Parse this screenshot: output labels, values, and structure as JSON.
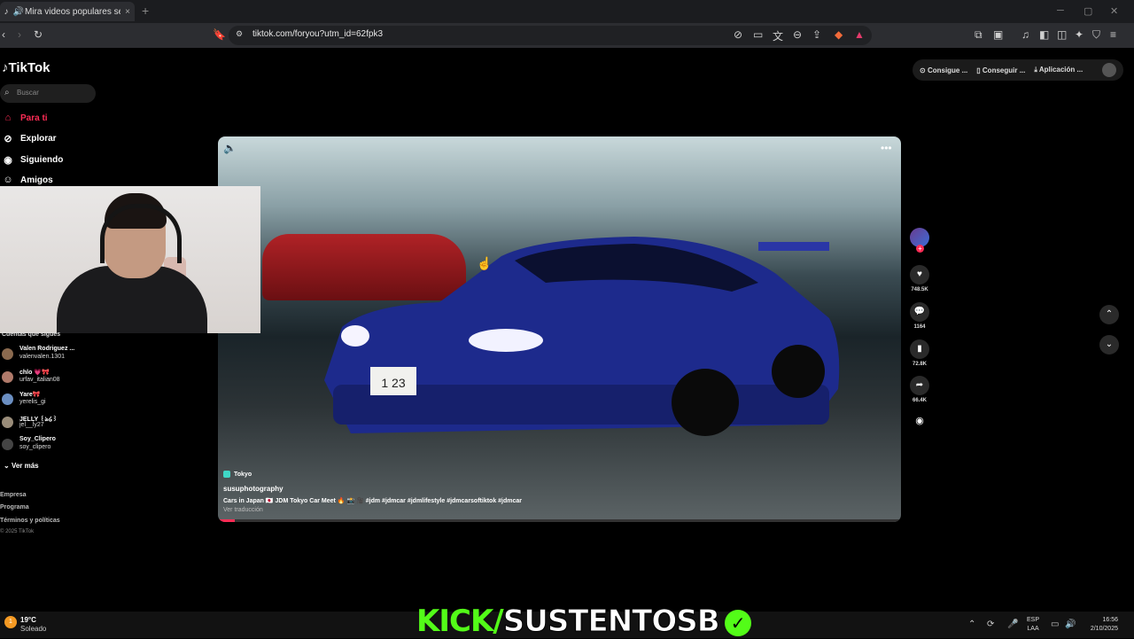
{
  "browser": {
    "tab_title": "Mira videos populares selecc",
    "tab_close": "×",
    "new_tab": "+",
    "url": "tiktok.com/foryou?utm_id=62fpk3"
  },
  "tiktok": {
    "logo": "TikTok",
    "search_placeholder": "Buscar",
    "nav": [
      {
        "label": "Para ti",
        "icon": "home-icon"
      },
      {
        "label": "Explorar",
        "icon": "compass-icon"
      },
      {
        "label": "Siguiendo",
        "icon": "following-icon"
      },
      {
        "label": "Amigos",
        "icon": "friends-icon"
      }
    ],
    "top_actions": [
      "Consigue ...",
      "Conseguir ...",
      "Aplicación ..."
    ],
    "following_title": "Cuentas que sigues",
    "accounts": [
      {
        "name": "Valen Rodriguez ...",
        "user": "valenvalen.1301",
        "color": "#8b6a4f"
      },
      {
        "name": "chlo 💗🎀",
        "user": "urfav_italian08",
        "color": "#b07a6a"
      },
      {
        "name": "Yare🎀",
        "user": "yerelis_gi",
        "color": "#6b8fc2"
      },
      {
        "name": "JELLY ꒰ঌ໒꒱",
        "user": "jel__ly27",
        "color": "#9a8d7a"
      },
      {
        "name": "Soy_Clipero",
        "user": "soy_clipero",
        "color": "#444"
      }
    ],
    "see_more": "Ver más",
    "footer": [
      "Empresa",
      "Programa",
      "Términos y políticas"
    ],
    "copyright": "© 2025 TikTok"
  },
  "video": {
    "location": "Tokyo",
    "author": "susuphotography",
    "caption": "Cars in Japan 🇯🇵 JDM Tokyo Car Meet 🔥 📸 🎥 #jdm #jdmcar #jdmlifestyle #jdmcarsoftiktok #jdmcar",
    "translate": "Ver traducción",
    "progress": 0.025,
    "plate": "1 23"
  },
  "actions": {
    "likes": "748.5K",
    "comments": "1164",
    "saves": "72.8K",
    "shares": "66.4K"
  },
  "taskbar": {
    "temp": "19°C",
    "condition": "Soleado",
    "lang1": "ESP",
    "lang2": "LAA",
    "time": "16:56",
    "date": "2/10/2025"
  },
  "overlay": {
    "kick": "KICK/",
    "channel": "SUSTENTOSB"
  }
}
